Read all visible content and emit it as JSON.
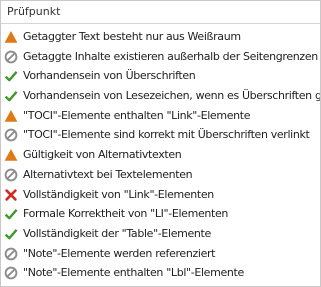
{
  "header": {
    "title": "Prüfpunkt"
  },
  "colors": {
    "warning": "#e07a14",
    "skipped": "#8d8d8d",
    "passed": "#3f9a2b",
    "failed": "#d02b20"
  },
  "items": [
    {
      "status": "warning",
      "icon": "warning-triangle-icon",
      "label": "Getaggter Text besteht nur aus Weißraum"
    },
    {
      "status": "skipped",
      "icon": "skipped-circle-icon",
      "label": "Getaggte Inhalte existieren außerhalb der Seitengrenzen"
    },
    {
      "status": "passed",
      "icon": "checkmark-icon",
      "label": "Vorhandensein von Überschriften"
    },
    {
      "status": "passed",
      "icon": "checkmark-icon",
      "label": "Vorhandensein von Lesezeichen, wenn es Überschriften gibt"
    },
    {
      "status": "warning",
      "icon": "warning-triangle-icon",
      "label": "\"TOCI\"-Elemente enthalten \"Link\"-Elemente"
    },
    {
      "status": "skipped",
      "icon": "skipped-circle-icon",
      "label": "\"TOCI\"-Elemente sind korrekt mit Überschriften verlinkt"
    },
    {
      "status": "warning",
      "icon": "warning-triangle-icon",
      "label": "Gültigkeit von Alternativtexten"
    },
    {
      "status": "skipped",
      "icon": "skipped-circle-icon",
      "label": "Alternativtext bei Textelementen"
    },
    {
      "status": "failed",
      "icon": "cross-icon",
      "label": "Vollständigkeit von \"Link\"-Elementen"
    },
    {
      "status": "passed",
      "icon": "checkmark-icon",
      "label": "Formale Korrektheit von \"LI\"-Elementen"
    },
    {
      "status": "passed",
      "icon": "checkmark-icon",
      "label": "Vollständigkeit der \"Table\"-Elemente"
    },
    {
      "status": "skipped",
      "icon": "skipped-circle-icon",
      "label": "\"Note\"-Elemente werden referenziert"
    },
    {
      "status": "skipped",
      "icon": "skipped-circle-icon",
      "label": "\"Note\"-Elemente enthalten \"Lbl\"-Elemente"
    }
  ]
}
